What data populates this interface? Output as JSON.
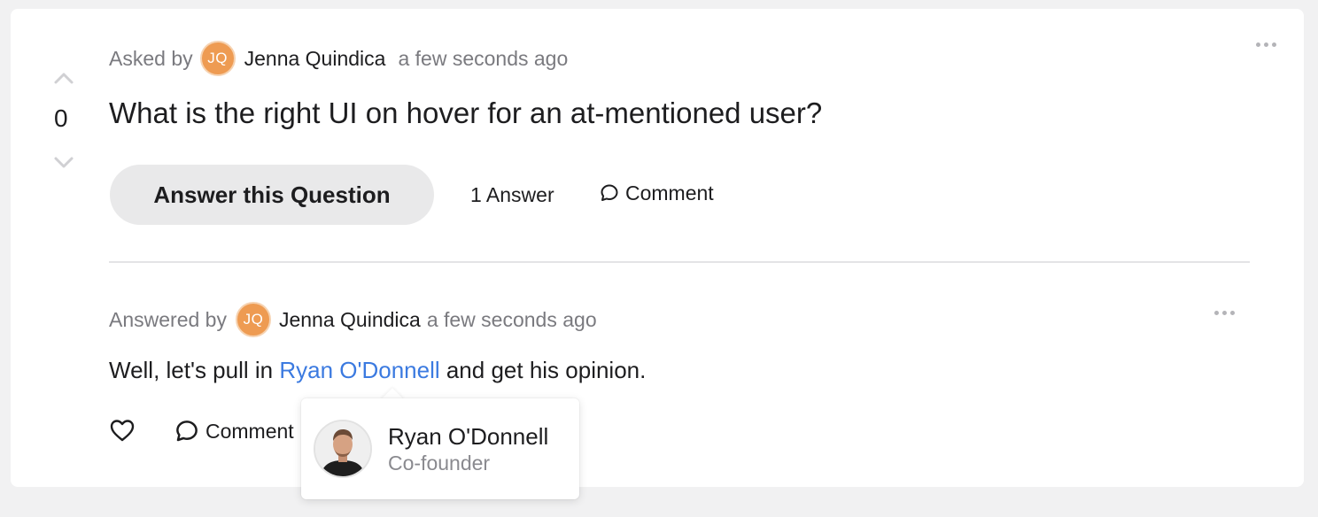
{
  "question": {
    "asked_prefix": "Asked by",
    "author_initials": "JQ",
    "author_name": "Jenna Quindica",
    "timestamp": "a few seconds ago",
    "vote_count": "0",
    "title": "What is the right UI on hover for an at-mentioned user?",
    "answer_button_label": "Answer this Question",
    "answer_count_label": "1 Answer",
    "comment_label": "Comment"
  },
  "answer": {
    "answered_prefix": "Answered by",
    "author_initials": "JQ",
    "author_name": "Jenna Quindica",
    "timestamp": "a few seconds ago",
    "body_before": "Well, let's pull in ",
    "mention": "Ryan O'Donnell",
    "body_after": " and get his opinion.",
    "comment_label": "Comment"
  },
  "popover": {
    "name": "Ryan O'Donnell",
    "role": "Co-founder"
  },
  "colors": {
    "accent_link": "#3b7ae0",
    "avatar_bg": "#ee9b52",
    "page_bg": "#f1f1f2"
  }
}
